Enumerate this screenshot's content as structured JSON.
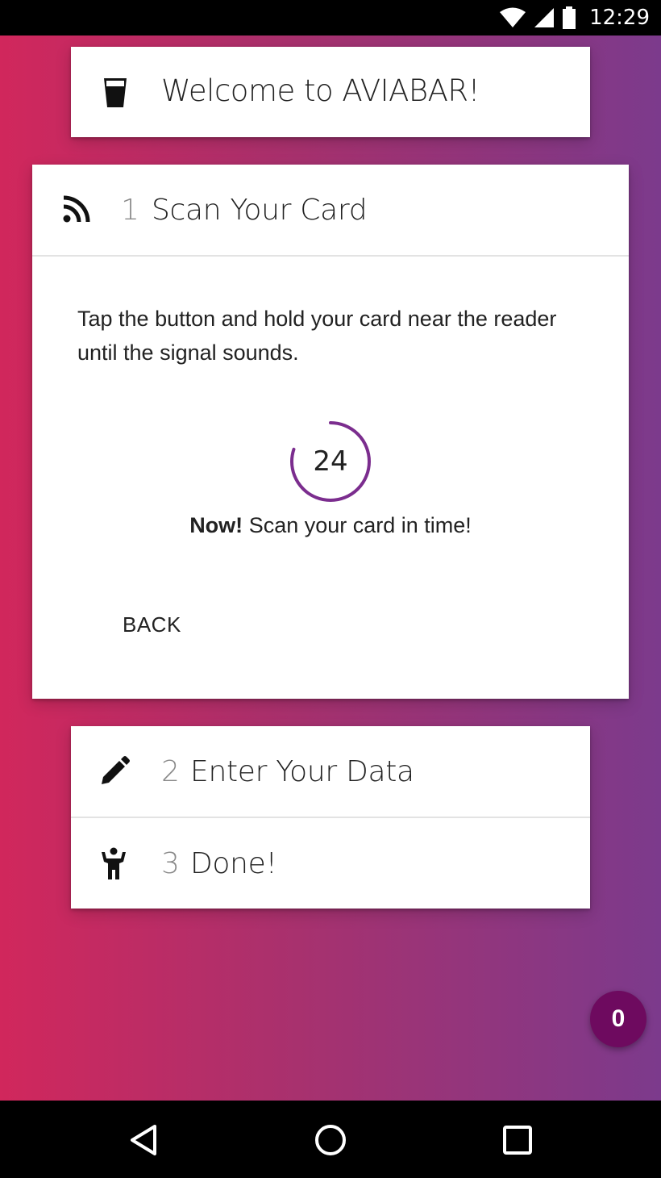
{
  "status_bar": {
    "time": "12:29"
  },
  "welcome": {
    "title": "Welcome to AVIABAR!"
  },
  "steps": [
    {
      "number": "1",
      "label": "Scan Your Card",
      "icon": "rss-feed-icon",
      "active": true
    },
    {
      "number": "2",
      "label": "Enter Your Data",
      "icon": "pencil-icon",
      "active": false
    },
    {
      "number": "3",
      "label": "Done!",
      "icon": "person-icon",
      "active": false
    }
  ],
  "scan": {
    "instructions": "Tap the button and hold your card near the reader until the signal sounds.",
    "countdown": "24",
    "countdown_progress": 0.8,
    "message_bold": "Now!",
    "message_rest": "Scan your card in time!",
    "back_label": "BACK"
  },
  "fab": {
    "count": "0"
  },
  "colors": {
    "gradient_start": "#d1275c",
    "gradient_end": "#7c3a8c",
    "timer_ring": "#7b2d8e",
    "fab": "#6e0a5f"
  }
}
